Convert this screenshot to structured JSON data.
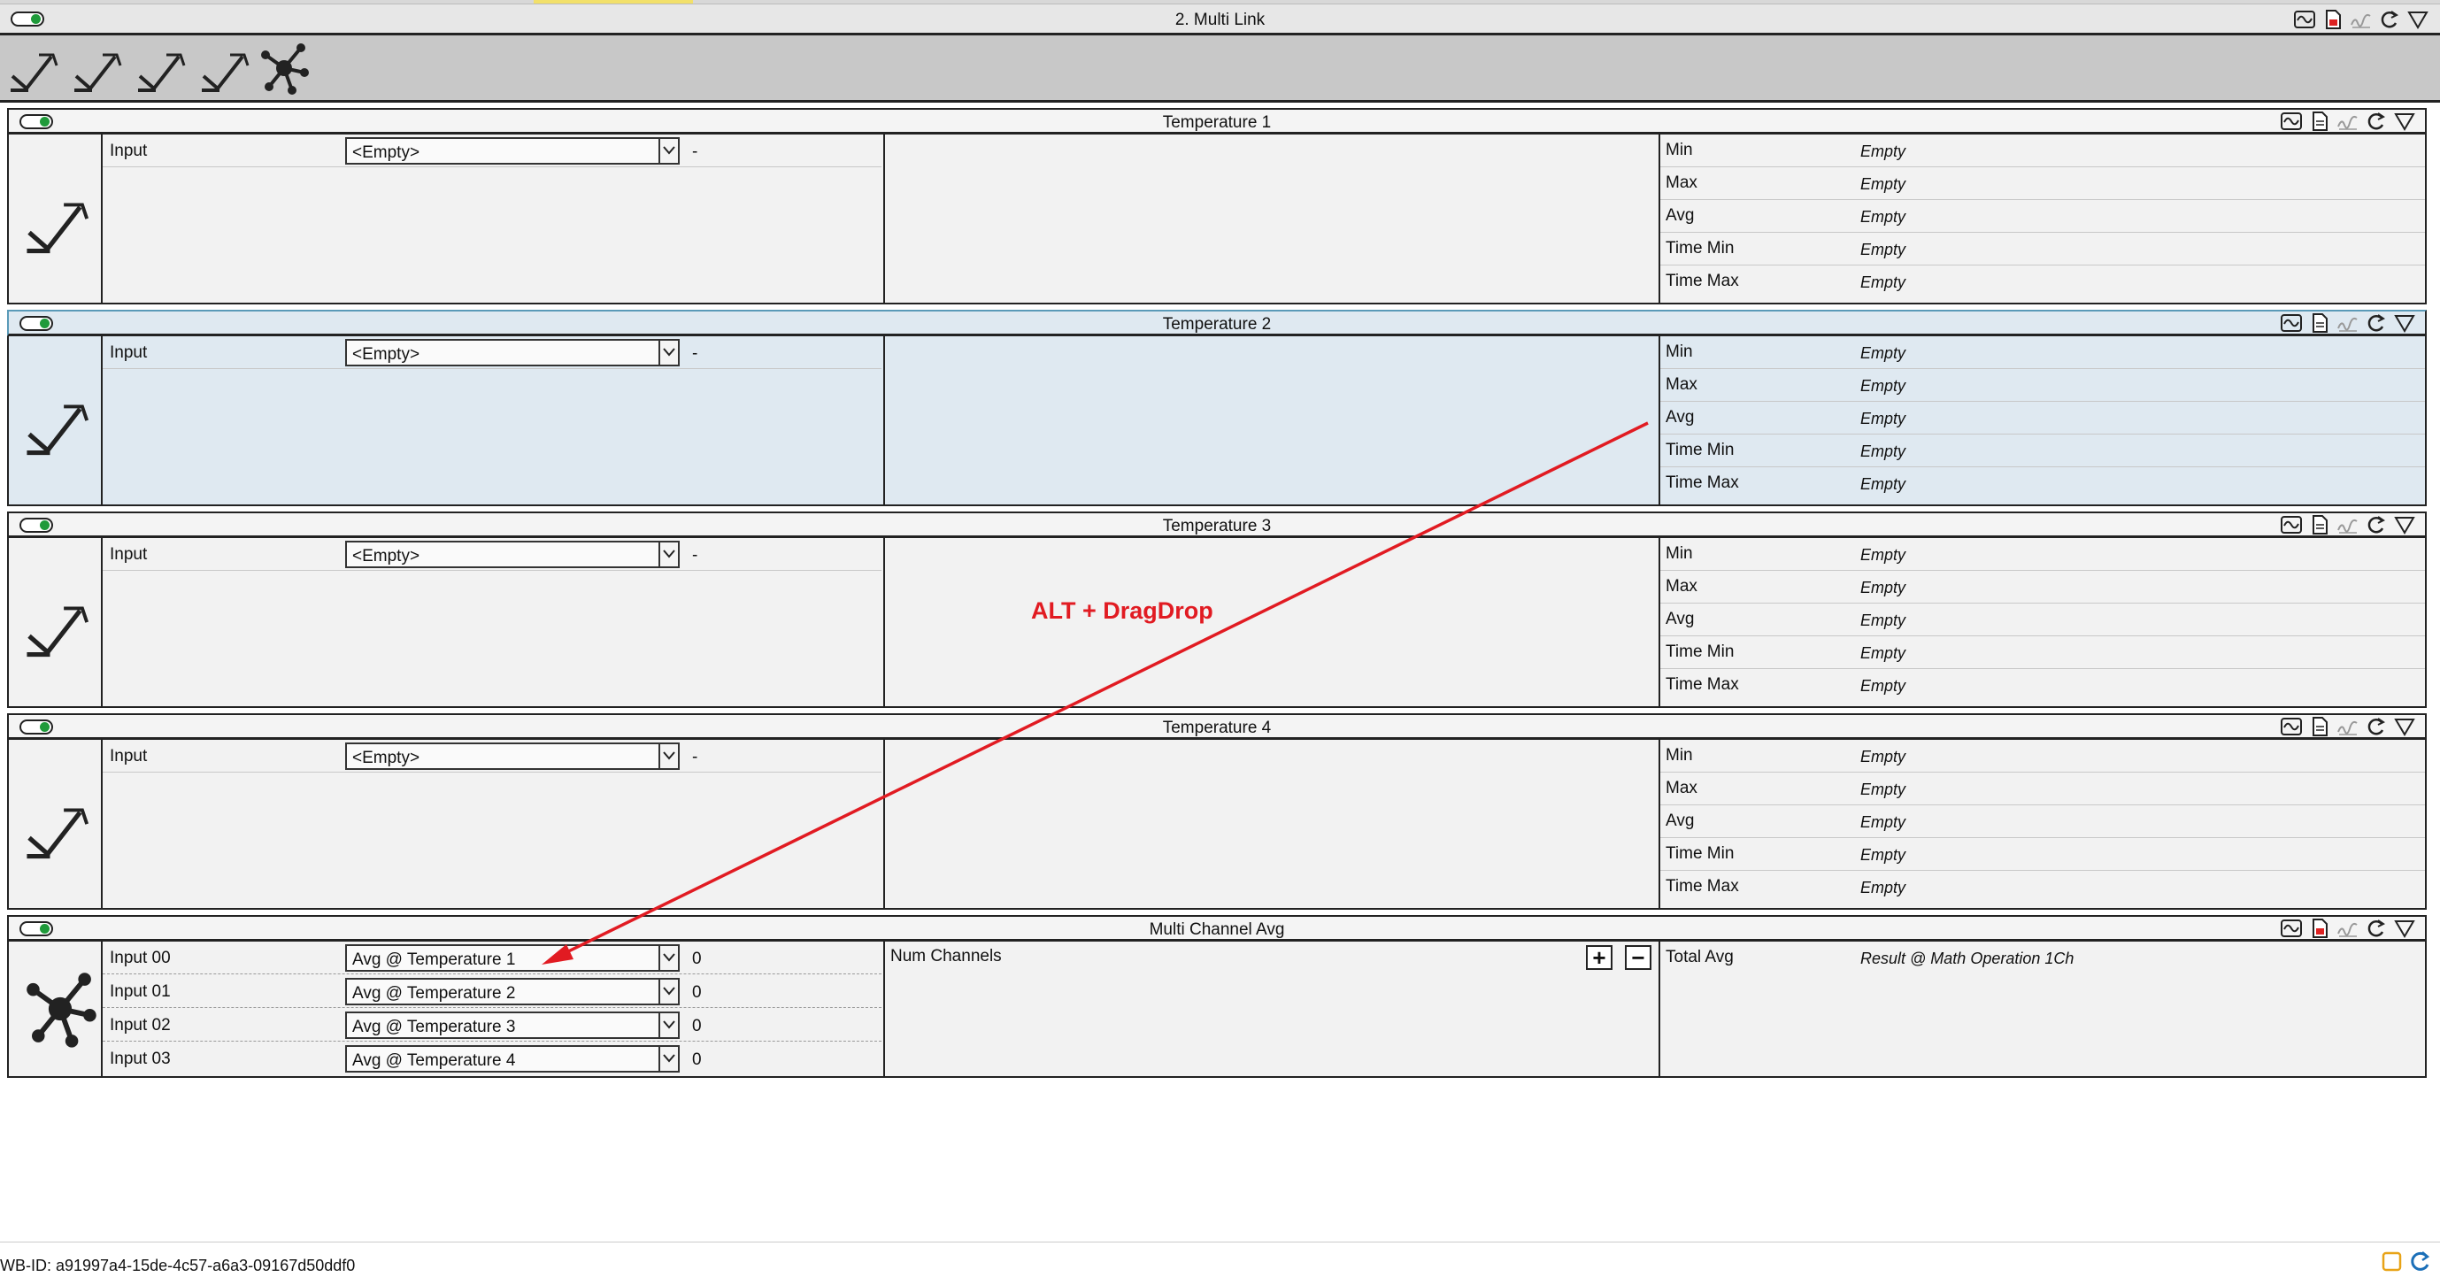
{
  "window": {
    "title": "2. Multi Link"
  },
  "header_icons": [
    "waveform-icon",
    "document-icon",
    "signature-icon",
    "refresh-icon",
    "filter-icon"
  ],
  "toolbar": {
    "items": [
      "trend-arrow-icon",
      "trend-arrow-icon",
      "trend-arrow-icon",
      "trend-arrow-icon",
      "molecule-icon"
    ]
  },
  "panels": [
    {
      "title": "Temperature 1",
      "inputs": [
        {
          "label": "Input",
          "value": "<Empty>",
          "num": "-"
        }
      ],
      "stats": [
        {
          "key": "Min",
          "value": "Empty"
        },
        {
          "key": "Max",
          "value": "Empty"
        },
        {
          "key": "Avg",
          "value": "Empty"
        },
        {
          "key": "Time Min",
          "value": "Empty"
        },
        {
          "key": "Time Max",
          "value": "Empty"
        }
      ]
    },
    {
      "title": "Temperature 2",
      "selected": true,
      "inputs": [
        {
          "label": "Input",
          "value": "<Empty>",
          "num": "-"
        }
      ],
      "stats": [
        {
          "key": "Min",
          "value": "Empty"
        },
        {
          "key": "Max",
          "value": "Empty"
        },
        {
          "key": "Avg",
          "value": "Empty"
        },
        {
          "key": "Time Min",
          "value": "Empty"
        },
        {
          "key": "Time Max",
          "value": "Empty"
        }
      ]
    },
    {
      "title": "Temperature 3",
      "inputs": [
        {
          "label": "Input",
          "value": "<Empty>",
          "num": "-"
        }
      ],
      "stats": [
        {
          "key": "Min",
          "value": "Empty"
        },
        {
          "key": "Max",
          "value": "Empty"
        },
        {
          "key": "Avg",
          "value": "Empty"
        },
        {
          "key": "Time Min",
          "value": "Empty"
        },
        {
          "key": "Time Max",
          "value": "Empty"
        }
      ]
    },
    {
      "title": "Temperature 4",
      "inputs": [
        {
          "label": "Input",
          "value": "<Empty>",
          "num": "-"
        }
      ],
      "stats": [
        {
          "key": "Min",
          "value": "Empty"
        },
        {
          "key": "Max",
          "value": "Empty"
        },
        {
          "key": "Avg",
          "value": "Empty"
        },
        {
          "key": "Time Min",
          "value": "Empty"
        },
        {
          "key": "Time Max",
          "value": "Empty"
        }
      ]
    },
    {
      "title": "Multi Channel Avg",
      "inputs": [
        {
          "label": "Input 00",
          "value": "Avg @ Temperature 1",
          "num": "0"
        },
        {
          "label": "Input 01",
          "value": "Avg @ Temperature 2",
          "num": "0"
        },
        {
          "label": "Input 02",
          "value": "Avg @ Temperature 3",
          "num": "0"
        },
        {
          "label": "Input 03",
          "value": "Avg @ Temperature 4",
          "num": "0"
        }
      ],
      "config": {
        "label": "Num Channels",
        "plus": "+",
        "minus": "−"
      },
      "stats": [
        {
          "key": "Total Avg",
          "value": "Result @ Math Operation 1Ch"
        }
      ]
    }
  ],
  "annotation": {
    "text": "ALT + DragDrop",
    "color": "#e11b22"
  },
  "status": {
    "wb_id": "WB-ID: a91997a4-15de-4c57-a6a3-09167d50ddf0"
  },
  "colors": {
    "accent_green": "#1f9a3a",
    "selected_bg": "#dfe9f1",
    "annotation_red": "#e11b22"
  }
}
